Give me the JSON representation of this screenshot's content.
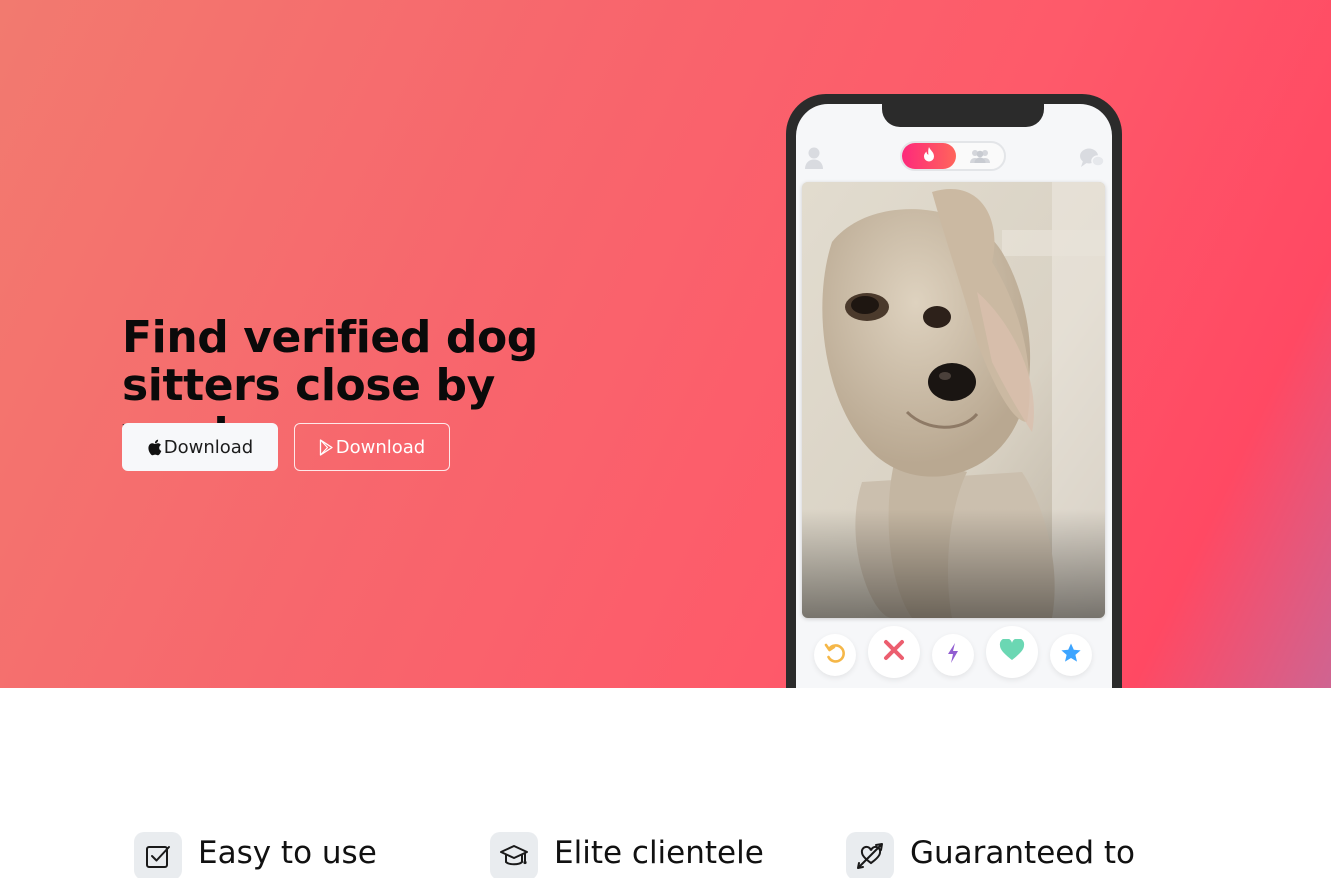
{
  "hero": {
    "headline": "Find verified dog sitters close by you!",
    "apple_button_label": "Download",
    "play_button_label": "Download"
  },
  "phone": {
    "tabs": [
      "flame-icon",
      "group-icon"
    ],
    "header_icons": [
      "profile-icon",
      "chat-icon"
    ],
    "card_image": "dog-photo",
    "actions": [
      {
        "name": "rewind",
        "icon": "rewind-icon",
        "color": "#f5b748"
      },
      {
        "name": "nope",
        "icon": "close-icon",
        "color": "#ec5e6f"
      },
      {
        "name": "boost",
        "icon": "bolt-icon",
        "color": "#915dd1"
      },
      {
        "name": "like",
        "icon": "heart-icon",
        "color": "#6bd7b3"
      },
      {
        "name": "super-like",
        "icon": "star-icon",
        "color": "#3ca4ff"
      }
    ]
  },
  "features": [
    {
      "title": "Easy to use",
      "icon": "checkbox-icon"
    },
    {
      "title": "Elite clientele",
      "icon": "graduation-cap-icon"
    },
    {
      "title": "Guaranteed to",
      "icon": "heart-arrow-icon"
    }
  ],
  "colors": {
    "gradient_start": "#f27a6f",
    "gradient_mid": "#fe5a6a",
    "gradient_end": "#ff4963",
    "gradient_corner": "#cf6491",
    "phone_frame": "#2b2b2b"
  }
}
